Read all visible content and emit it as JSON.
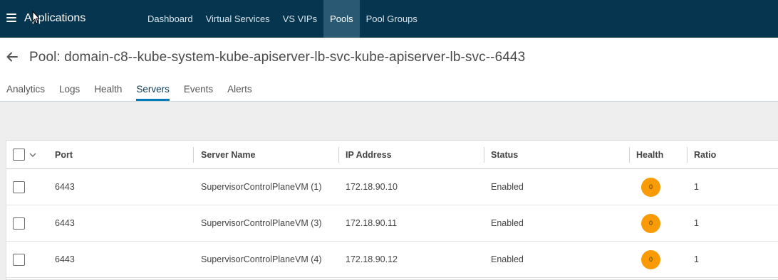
{
  "topbar": {
    "app_title": "Applications",
    "nav": [
      {
        "label": "Dashboard",
        "active": false
      },
      {
        "label": "Virtual Services",
        "active": false
      },
      {
        "label": "VS VIPs",
        "active": false
      },
      {
        "label": "Pools",
        "active": true
      },
      {
        "label": "Pool Groups",
        "active": false
      }
    ],
    "colors": {
      "background": "#06364f",
      "active_background": "#2a5973"
    },
    "icons": {
      "menu": "hamburger-menu-icon",
      "cursor": "mouse-pointer-icon"
    }
  },
  "header": {
    "title": "Pool: domain-c8--kube-system-kube-apiserver-lb-svc-kube-apiserver-lb-svc--6443",
    "back_icon": "back-arrow-icon"
  },
  "tabs": [
    {
      "label": "Analytics",
      "active": false
    },
    {
      "label": "Logs",
      "active": false
    },
    {
      "label": "Health",
      "active": false
    },
    {
      "label": "Servers",
      "active": true
    },
    {
      "label": "Events",
      "active": false
    },
    {
      "label": "Alerts",
      "active": false
    }
  ],
  "table": {
    "columns": {
      "port": "Port",
      "server_name": "Server Name",
      "ip_address": "IP Address",
      "status": "Status",
      "health": "Health",
      "ratio": "Ratio"
    },
    "rows": [
      {
        "port": "6443",
        "server_name": "SupervisorControlPlaneVM (1)",
        "ip_address": "172.18.90.10",
        "status": "Enabled",
        "health": "0",
        "ratio": "1"
      },
      {
        "port": "6443",
        "server_name": "SupervisorControlPlaneVM (3)",
        "ip_address": "172.18.90.11",
        "status": "Enabled",
        "health": "0",
        "ratio": "1"
      },
      {
        "port": "6443",
        "server_name": "SupervisorControlPlaneVM (4)",
        "ip_address": "172.18.90.12",
        "status": "Enabled",
        "health": "0",
        "ratio": "1"
      }
    ],
    "health_badge_color": "#f89b06"
  }
}
